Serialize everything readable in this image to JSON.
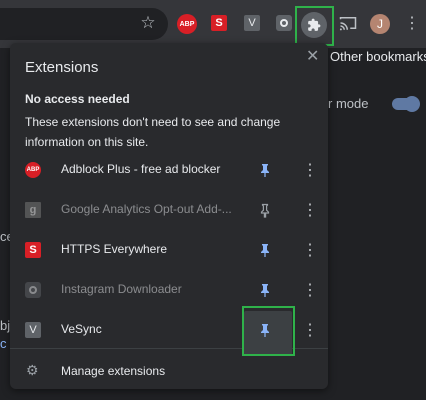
{
  "toolbar": {
    "star_icon": "star-icon",
    "ext_abp_icon_text": "ABP",
    "ext_s_icon_text": "S",
    "ext_v_icon_text": "V",
    "avatar_initial": "J",
    "highlight_color": "#2fb24a"
  },
  "bookmarks_bar": {
    "other_bookmarks": "Other bookmarks"
  },
  "background": {
    "mode_fragment": "r mode",
    "left_fragment_1": "ce",
    "left_fragment_2": "bj",
    "left_fragment_3": "c"
  },
  "panel": {
    "title": "Extensions",
    "section_heading": "No access needed",
    "section_description": "These extensions don't need to see and change information on this site.",
    "extensions": [
      {
        "name": "Adblock Plus - free ad blocker",
        "icon_text": "ABP",
        "pinned": true,
        "dimmed": false
      },
      {
        "name": "Google Analytics Opt-out Add-...",
        "icon_text": "g",
        "pinned": false,
        "dimmed": true
      },
      {
        "name": "HTTPS Everywhere",
        "icon_text": "S",
        "pinned": true,
        "dimmed": false
      },
      {
        "name": "Instagram Downloader",
        "icon_text": "",
        "pinned": true,
        "dimmed": true
      },
      {
        "name": "VeSync",
        "icon_text": "V",
        "pinned": true,
        "dimmed": false
      }
    ],
    "manage_label": "Manage extensions"
  },
  "colors": {
    "pin_active": "#8ab4f8",
    "pin_inactive": "#9aa0a6"
  }
}
